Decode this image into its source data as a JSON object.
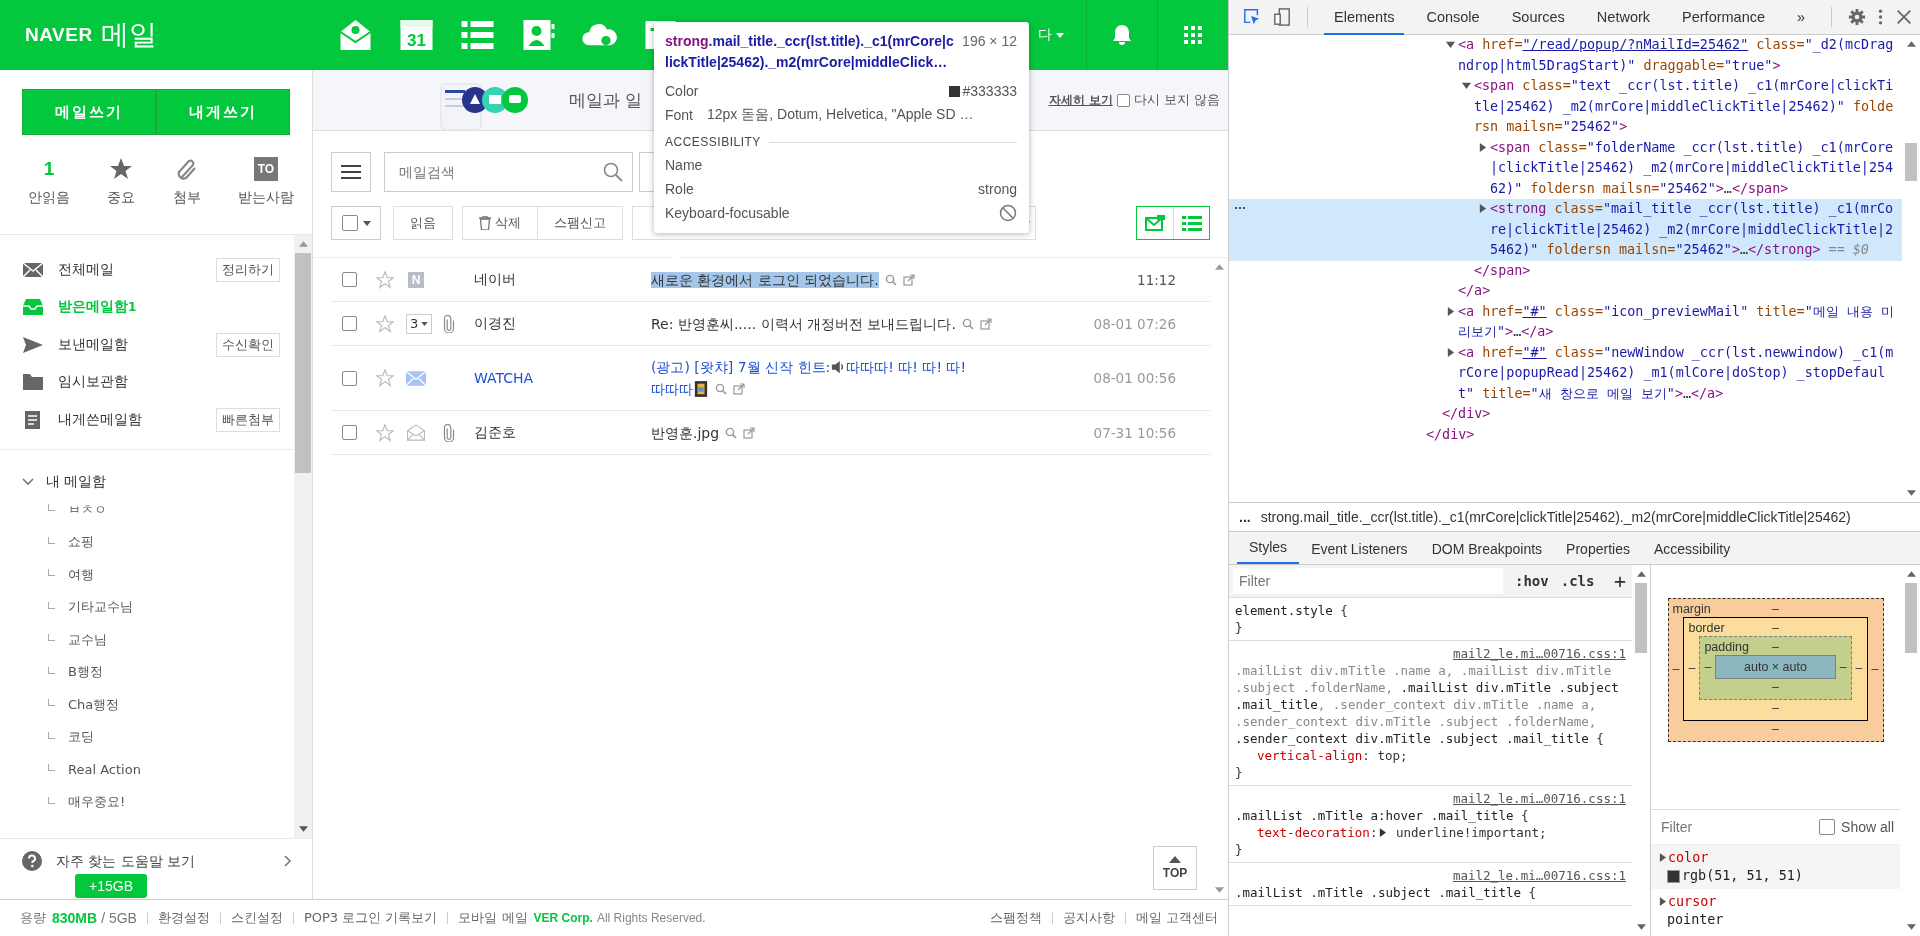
{
  "header": {
    "brand": "NAVER",
    "product": "메일",
    "calendar_day": "31",
    "user_name": "다"
  },
  "banner": {
    "title": "메일과 일",
    "more_link": "자세히 보기",
    "dismiss": {
      "label": "다시 보지 않음",
      "checked": false
    }
  },
  "sidebar": {
    "compose_buttons": [
      "메일쓰기",
      "내게쓰기"
    ],
    "quick_filters": [
      {
        "kind": "count",
        "value": "1",
        "label": "안읽음"
      },
      {
        "kind": "star",
        "label": "중요"
      },
      {
        "kind": "clip",
        "label": "첨부"
      },
      {
        "kind": "to",
        "badge": "TO",
        "label": "받는사람"
      }
    ],
    "folders": [
      {
        "kind": "all",
        "label": "전체메일",
        "action": "정리하기",
        "selected": false
      },
      {
        "kind": "inbox",
        "label": "받은메일함",
        "count": "1",
        "selected": true
      },
      {
        "kind": "sent",
        "label": "보낸메일함",
        "action": "수신확인",
        "selected": false
      },
      {
        "kind": "draft",
        "label": "임시보관함",
        "selected": false
      },
      {
        "kind": "self",
        "label": "내게쓴메일함",
        "action": "빠른첨부",
        "selected": false
      }
    ],
    "my_folders": {
      "label": "내 메일함",
      "expanded": true,
      "children": [
        {
          "label": "ㅂㅊㅇ"
        },
        {
          "label": "쇼핑"
        },
        {
          "label": "여행"
        },
        {
          "label": "기타교수님"
        },
        {
          "label": "교수님"
        },
        {
          "label": "B행정"
        },
        {
          "label": "Cha행정"
        },
        {
          "label": "코딩"
        },
        {
          "label": "Real Action"
        },
        {
          "label": "매우중요!"
        }
      ]
    },
    "help": "자주 찾는 도움말 보기",
    "storage_badge": "+15GB"
  },
  "toolbar": {
    "search_placeholder": "메일검색",
    "actions": [
      "읽음",
      "삭제",
      "스팸신고"
    ]
  },
  "mails": [
    {
      "kind": "naver",
      "badge": "N",
      "checked": false,
      "starred": false,
      "attachment": false,
      "unread": true,
      "sender": "네이버",
      "subject": "새로운 환경에서 로그인 되었습니다.",
      "highlighted": true,
      "time": "11:12"
    },
    {
      "kind": "thread",
      "thread_count": "3",
      "checked": false,
      "starred": false,
      "attachment": true,
      "unread": false,
      "sender": "이경진",
      "subject": "Re: 반영훈씨..... 이력서 개정버전 보내드립니다.",
      "highlighted": false,
      "time": "08-01 07:26"
    },
    {
      "kind": "ad",
      "checked": false,
      "starred": false,
      "attachment": false,
      "unread": false,
      "sender": "WATCHA",
      "subject": "(광고) [왓챠] 7월 신작 힌트:",
      "subject_rest": "따따따! 따! 따! 따!",
      "subject_tail": "따따따",
      "highlighted": false,
      "time": "08-01 00:56"
    },
    {
      "kind": "read",
      "checked": false,
      "starred": false,
      "attachment": true,
      "unread": false,
      "sender": "김준호",
      "subject": "반영훈.jpg",
      "highlighted": false,
      "time": "07-31 10:56"
    }
  ],
  "top_button": "TOP",
  "footer": {
    "quota_label": "용량",
    "quota_used": "830MB",
    "quota_total": "/ 5GB",
    "links": [
      "환경설정",
      "스킨설정",
      "POP3 로그인 기록보기",
      "모바일 메일"
    ],
    "corp": "VER Corp.",
    "rights": "All Rights Reserved.",
    "right_links": [
      "스팸정책",
      "공지사항",
      "메일 고객센터"
    ]
  },
  "tooltip": {
    "tag": "strong",
    "selector": ".mail_title._ccr(lst.title)._c1(mrCore|clickTitle|25462)._m2(mrCore|middleClick…",
    "size": "196 × 12",
    "color_label": "Color",
    "color_value": "#333333",
    "font_label": "Font",
    "font_value": "12px 돋움, Dotum, Helvetica, \"Apple SD …",
    "section": "ACCESSIBILITY",
    "rows": [
      {
        "kind": "text",
        "label": "Name"
      },
      {
        "kind": "text",
        "label": "Role",
        "value": "strong"
      },
      {
        "kind": "blocked",
        "label": "Keyboard-focusable"
      }
    ]
  },
  "devtools": {
    "tabs": [
      {
        "label": "Elements",
        "selected": true
      },
      {
        "label": "Console",
        "selected": false
      },
      {
        "label": "Sources",
        "selected": false
      },
      {
        "label": "Network",
        "selected": false
      },
      {
        "label": "Performance",
        "selected": false
      }
    ],
    "more_tabs": "»",
    "dom_tree": [
      {
        "children": [
          {
            "children": [
              {
                "selected": false,
                "expanded": true,
                "open": [
                  {
                    "kind": "tag",
                    "s": "<a"
                  },
                  {
                    "kind": "attr",
                    "s": " href="
                  },
                  {
                    "kind": "link",
                    "s": "\"/read/popup/?nMailId=25462\""
                  },
                  {
                    "kind": "attr",
                    "s": " class="
                  },
                  {
                    "kind": "val",
                    "s": "\"_d2(mcDragndrop|html5DragStart)\""
                  },
                  {
                    "kind": "attr",
                    "s": " draggable="
                  },
                  {
                    "kind": "val",
                    "s": "\"true\""
                  },
                  {
                    "kind": "tag",
                    "s": ">"
                  }
                ],
                "children": [
                  {
                    "selected": false,
                    "expanded": true,
                    "open": [
                      {
                        "kind": "tag",
                        "s": "<span"
                      },
                      {
                        "kind": "attr",
                        "s": " class="
                      },
                      {
                        "kind": "val",
                        "s": "\"text _ccr(lst.title) _c1(mrCore|clickTitle|25462) _m2(mrCore|middleClickTitle|25462)\""
                      },
                      {
                        "kind": "attr",
                        "s": " foldersn mailsn="
                      },
                      {
                        "kind": "val",
                        "s": "\"25462\""
                      },
                      {
                        "kind": "tag",
                        "s": ">"
                      }
                    ],
                    "children": [
                      {
                        "selected": false,
                        "expanded": false,
                        "open": [
                          {
                            "kind": "tag",
                            "s": "<span"
                          },
                          {
                            "kind": "attr",
                            "s": " class="
                          },
                          {
                            "kind": "val",
                            "s": "\"folderName _ccr(lst.title) _c1(mrCore|clickTitle|25462) _m2(mrCore|middleClickTitle|25462)\""
                          },
                          {
                            "kind": "attr",
                            "s": " foldersn mailsn="
                          },
                          {
                            "kind": "val",
                            "s": "\"25462\""
                          },
                          {
                            "kind": "tag",
                            "s": ">"
                          },
                          {
                            "kind": "plain",
                            "s": "…"
                          },
                          {
                            "kind": "tag",
                            "s": "</span>"
                          }
                        ]
                      },
                      {
                        "selected": true,
                        "expanded": false,
                        "open": [
                          {
                            "kind": "tag",
                            "s": "<strong"
                          },
                          {
                            "kind": "attr",
                            "s": " class="
                          },
                          {
                            "kind": "val",
                            "s": "\"mail_title _ccr(lst.title) _c1(mrCore|clickTitle|25462) _m2(mrCore|middleClickTitle|25462)\""
                          },
                          {
                            "kind": "attr",
                            "s": " foldersn mailsn="
                          },
                          {
                            "kind": "val",
                            "s": "\"25462\""
                          },
                          {
                            "kind": "tag",
                            "s": ">"
                          },
                          {
                            "kind": "plain",
                            "s": "…"
                          },
                          {
                            "kind": "tag",
                            "s": "</strong>"
                          },
                          {
                            "kind": "ref",
                            "s": " == $0"
                          }
                        ]
                      }
                    ],
                    "close": [
                      {
                        "kind": "tag",
                        "s": "</span>"
                      }
                    ]
                  }
                ],
                "close": [
                  {
                    "kind": "tag",
                    "s": "</a>"
                  }
                ]
              },
              {
                "selected": false,
                "expanded": false,
                "open": [
                  {
                    "kind": "tag",
                    "s": "<a"
                  },
                  {
                    "kind": "attr",
                    "s": " href="
                  },
                  {
                    "kind": "link",
                    "s": "\"#\""
                  },
                  {
                    "kind": "attr",
                    "s": " class="
                  },
                  {
                    "kind": "val",
                    "s": "\"icon_previewMail\""
                  },
                  {
                    "kind": "attr",
                    "s": " title="
                  },
                  {
                    "kind": "val",
                    "s": "\"메일 내용 미리보기\""
                  },
                  {
                    "kind": "tag",
                    "s": ">"
                  },
                  {
                    "kind": "plain",
                    "s": "…"
                  },
                  {
                    "kind": "tag",
                    "s": "</a>"
                  }
                ]
              },
              {
                "selected": false,
                "expanded": false,
                "open": [
                  {
                    "kind": "tag",
                    "s": "<a"
                  },
                  {
                    "kind": "attr",
                    "s": " href="
                  },
                  {
                    "kind": "link",
                    "s": "\"#\""
                  },
                  {
                    "kind": "attr",
                    "s": " class="
                  },
                  {
                    "kind": "val",
                    "s": "\"newWindow _ccr(lst.newwindow) _c1(mrCore|popupRead|25462) _m1(mlCore|doStop) _stopDefault\""
                  },
                  {
                    "kind": "attr",
                    "s": " title="
                  },
                  {
                    "kind": "val",
                    "s": "\"새 창으로 메일 보기\""
                  },
                  {
                    "kind": "tag",
                    "s": ">"
                  },
                  {
                    "kind": "plain",
                    "s": "…"
                  },
                  {
                    "kind": "tag",
                    "s": "</a>"
                  }
                ]
              }
            ],
            "close": [
              {
                "kind": "tag",
                "s": "</div>"
              }
            ]
          }
        ],
        "close": [
          {
            "kind": "tag",
            "s": "</div>"
          }
        ]
      }
    ],
    "breadcrumb_more": "...",
    "breadcrumb": "strong.mail_title._ccr(lst.title)._c1(mrCore|clickTitle|25462)._m2(mrCore|middleClickTitle|25462)",
    "sub_tabs": [
      {
        "label": "Styles",
        "selected": true
      },
      {
        "label": "Event Listeners",
        "selected": false
      },
      {
        "label": "DOM Breakpoints",
        "selected": false
      },
      {
        "label": "Properties",
        "selected": false
      },
      {
        "label": "Accessibility",
        "selected": false
      }
    ],
    "styles_filter": {
      "placeholder": "Filter"
    },
    "hov": ":hov",
    "cls": ".cls",
    "add": "+",
    "rules": [
      {
        "selector": [
          {
            "text": "element.style",
            "matched": true
          }
        ],
        "open": "{",
        "close": "}"
      },
      {
        "source": "mail2_le.mi…00716.css:1",
        "selector": [
          {
            "text": ".mailList div.mTitle .name a, .mailList div.mTitle .subject .folderName, ",
            "matched": false
          },
          {
            "text": ".mailList div.mTitle .subject .mail_title",
            "matched": true
          },
          {
            "text": ", .sender_context div.mTitle .name a, .sender_context div.mTitle .subject .folderName, ",
            "matched": false
          },
          {
            "text": ".sender_context div.mTitle .subject .mail_title",
            "matched": true
          }
        ],
        "open": "{",
        "props": [
          {
            "name": "vertical-align",
            "sep": ":",
            "value": "top;",
            "expandable": false
          }
        ],
        "close": "}"
      },
      {
        "source": "mail2_le.mi…00716.css:1",
        "selector": [
          {
            "text": ".mailList .mTitle a:hover .mail_title",
            "matched": true
          }
        ],
        "open": "{",
        "props": [
          {
            "name": "text-decoration",
            "sep": ":",
            "value": "underline!important;",
            "expandable": true
          }
        ],
        "close": "}"
      },
      {
        "source": "mail2_le.mi…00716.css:1",
        "selector": [
          {
            "text": ".mailList .mTitle .subject .mail_title",
            "matched": true
          }
        ],
        "open": "{"
      }
    ],
    "box_model": {
      "margin": "margin",
      "border": "border",
      "padding": "padding",
      "content": "auto × auto",
      "dash": "–"
    },
    "computed_filter": {
      "placeholder": "Filter"
    },
    "show_all": {
      "label": "Show all",
      "checked": false
    },
    "computed": [
      {
        "kind": "color",
        "name": "color",
        "value": "rgb(51, 51, 51)"
      },
      {
        "kind": "keyword",
        "name": "cursor",
        "value": "pointer"
      }
    ]
  }
}
